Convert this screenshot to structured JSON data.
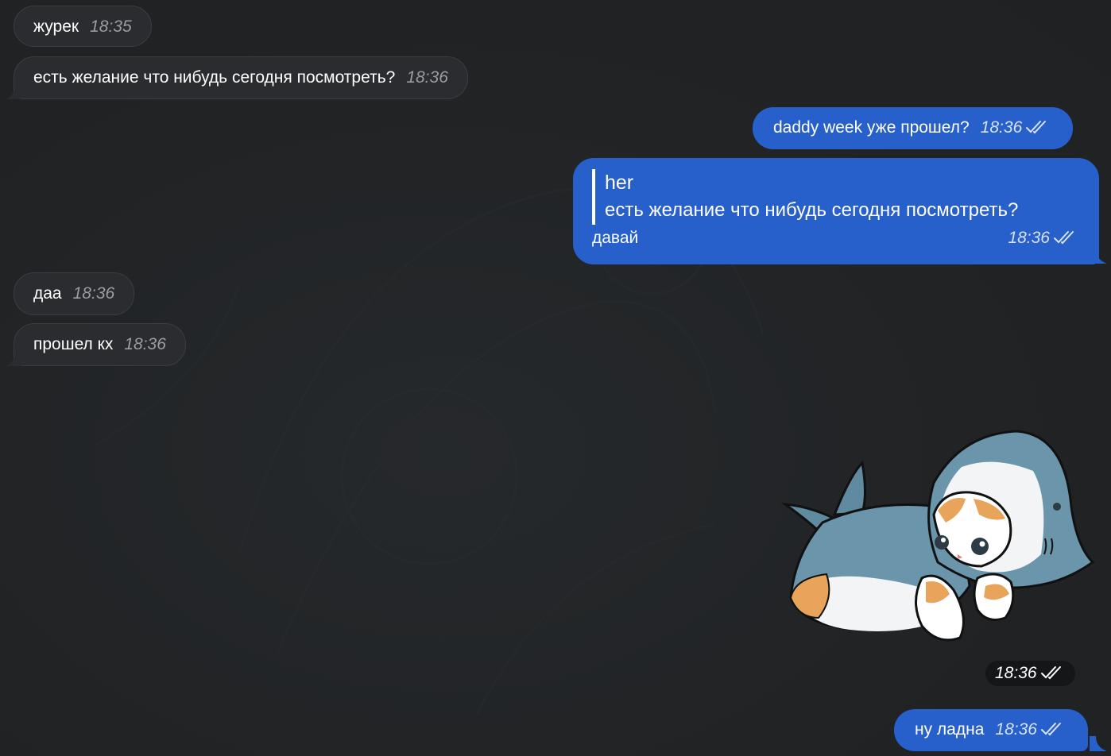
{
  "colors": {
    "background": "#212325",
    "incoming_bubble": "#2a2c2f",
    "outgoing_bubble": "#2760cb",
    "quote_bar": "#ffffff"
  },
  "messages": [
    {
      "direction": "incoming",
      "text": "журек",
      "time": "18:35"
    },
    {
      "direction": "incoming",
      "text": "есть желание что нибудь сегодня посмотреть?",
      "time": "18:36"
    },
    {
      "direction": "outgoing",
      "text": "daddy week уже прошел?",
      "time": "18:36",
      "status": "read-double-check-icon"
    },
    {
      "direction": "outgoing",
      "reply_to": {
        "author": "her",
        "text": "есть желание что нибудь сегодня посмотреть?"
      },
      "text": "давай",
      "time": "18:36",
      "status": "read-double-check-icon"
    },
    {
      "direction": "incoming",
      "text": "даа",
      "time": "18:36"
    },
    {
      "direction": "incoming",
      "text": "прошел кх",
      "time": "18:36"
    },
    {
      "direction": "outgoing",
      "type": "sticker",
      "sticker": "cat-in-shark-costume",
      "time": "18:36",
      "status": "read-double-check-icon"
    },
    {
      "direction": "outgoing",
      "text": "ну ладна",
      "time": "18:36",
      "status": "read-double-check-icon"
    }
  ]
}
